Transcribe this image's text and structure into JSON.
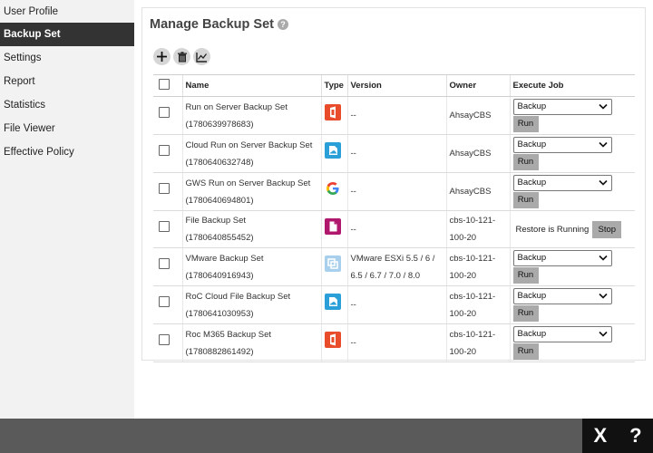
{
  "sidebar": {
    "items": [
      {
        "label": "User Profile",
        "active": false
      },
      {
        "label": "Backup Set",
        "active": true
      },
      {
        "label": "Settings",
        "active": false
      },
      {
        "label": "Report",
        "active": false
      },
      {
        "label": "Statistics",
        "active": false
      },
      {
        "label": "File Viewer",
        "active": false
      },
      {
        "label": "Effective Policy",
        "active": false
      }
    ]
  },
  "panel": {
    "title": "Manage Backup Set",
    "help": "?"
  },
  "toolbar": {
    "icons": [
      "add-icon",
      "delete-icon",
      "chart-icon"
    ]
  },
  "table": {
    "headers": {
      "name": "Name",
      "type": "Type",
      "version": "Version",
      "owner": "Owner",
      "execute": "Execute Job"
    },
    "rows": [
      {
        "name": "Run on Server Backup Set",
        "id": "(1780639978683)",
        "type_icon": "office365-icon",
        "version": "--",
        "owner": "AhsayCBS",
        "job": "Backup",
        "run": "Run"
      },
      {
        "name": "Cloud Run on Server Backup Set",
        "id": "(1780640632748)",
        "type_icon": "cloud-file-icon",
        "version": "--",
        "owner": "AhsayCBS",
        "job": "Backup",
        "run": "Run"
      },
      {
        "name": "GWS Run on Server Backup Set",
        "id": "(1780640694801)",
        "type_icon": "google-icon",
        "version": "--",
        "owner": "AhsayCBS",
        "job": "Backup",
        "run": "Run"
      },
      {
        "name": "File Backup Set",
        "id": "(1780640855452)",
        "type_icon": "file-icon",
        "version": "--",
        "owner": "cbs-10-121-100-20",
        "status": "Restore is Running",
        "stop": "Stop"
      },
      {
        "name": "VMware Backup Set",
        "id": "(1780640916943)",
        "type_icon": "vmware-icon",
        "version": "VMware ESXi 5.5 / 6 / 6.5 / 6.7 / 7.0 / 8.0",
        "owner": "cbs-10-121-100-20",
        "job": "Backup",
        "run": "Run"
      },
      {
        "name": "RoC Cloud File Backup Set",
        "id": "(1780641030953)",
        "type_icon": "cloud-file-icon",
        "version": "--",
        "owner": "cbs-10-121-100-20",
        "job": "Backup",
        "run": "Run"
      },
      {
        "name": "Roc M365 Backup Set",
        "id": "(1780882861492)",
        "type_icon": "office365-icon",
        "version": "--",
        "owner": "cbs-10-121-100-20",
        "job": "Backup",
        "run": "Run"
      }
    ]
  },
  "bottom": {
    "close": "X",
    "help": "?"
  },
  "colors": {
    "office": "#e84c2b",
    "cloud": "#2b9fd8",
    "file": "#b0186e",
    "vmware": "#7fb8e0",
    "sidebar_active": "#333333"
  }
}
